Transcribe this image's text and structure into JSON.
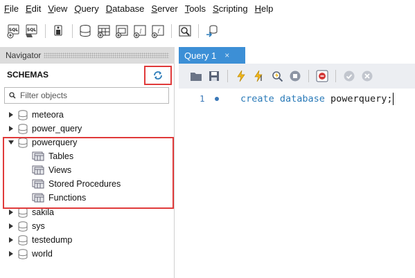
{
  "menubar": {
    "items": [
      {
        "label": "File",
        "key": "F",
        "rest": "ile"
      },
      {
        "label": "Edit",
        "key": "E",
        "rest": "dit"
      },
      {
        "label": "View",
        "key": "V",
        "rest": "iew"
      },
      {
        "label": "Query",
        "key": "Q",
        "rest": "uery"
      },
      {
        "label": "Database",
        "key": "D",
        "rest": "atabase"
      },
      {
        "label": "Server",
        "key": "S",
        "rest": "erver"
      },
      {
        "label": "Tools",
        "key": "T",
        "rest": "ools"
      },
      {
        "label": "Scripting",
        "key": "S",
        "rest": "cripting"
      },
      {
        "label": "Help",
        "key": "H",
        "rest": "elp"
      }
    ]
  },
  "toolbar": {
    "new_sql_tab_icon_label": "SQL",
    "open_sql_icon_label": "SQL"
  },
  "navigator": {
    "header": "Navigator",
    "schemas_title": "SCHEMAS",
    "filter_placeholder": "Filter objects",
    "schemas": [
      {
        "name": "meteora",
        "expanded": false
      },
      {
        "name": "power_query",
        "expanded": false
      },
      {
        "name": "powerquery",
        "expanded": true,
        "children": [
          "Tables",
          "Views",
          "Stored Procedures",
          "Functions"
        ]
      },
      {
        "name": "sakila",
        "expanded": false
      },
      {
        "name": "sys",
        "expanded": false
      },
      {
        "name": "testedump",
        "expanded": false
      },
      {
        "name": "world",
        "expanded": false
      }
    ]
  },
  "query_tab": {
    "label": "Query 1",
    "close_glyph": "×"
  },
  "editor": {
    "line_number": "1",
    "code_keyword": "create database",
    "code_identifier": " powerquery",
    "code_terminator": ";"
  },
  "colors": {
    "tab_active": "#3c8fd6",
    "highlight": "#e03a3a",
    "keyword": "#2a7ab8"
  }
}
